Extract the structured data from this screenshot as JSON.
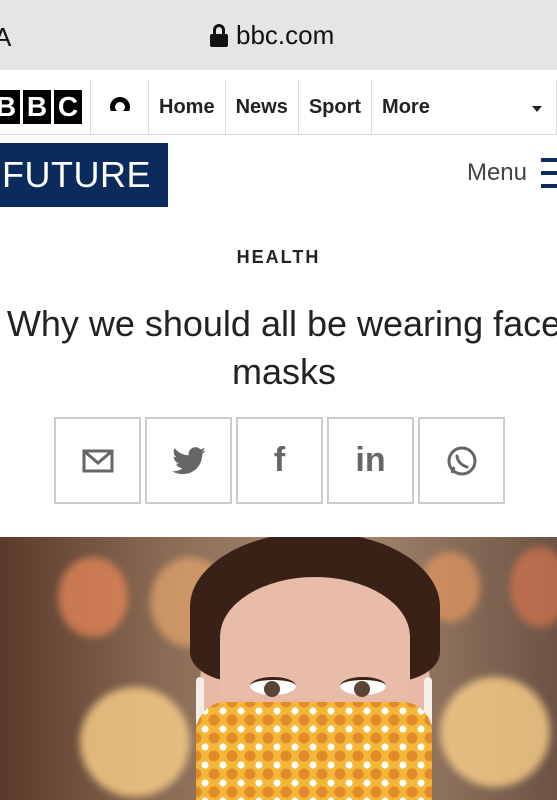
{
  "browser": {
    "text_size_button": "A",
    "url": "bbc.com"
  },
  "nav": {
    "logo": [
      "B",
      "B",
      "C"
    ],
    "items": [
      "Home",
      "News",
      "Sport",
      "More"
    ]
  },
  "section_banner": {
    "title": "FUTURE",
    "menu_label": "Menu"
  },
  "article": {
    "section": "HEALTH",
    "headline": "Why we should all be wearing face masks",
    "share": [
      {
        "name": "email",
        "icon": "email-icon"
      },
      {
        "name": "twitter",
        "icon": "twitter-icon"
      },
      {
        "name": "facebook",
        "icon": "facebook-icon",
        "glyph": "f"
      },
      {
        "name": "linkedin",
        "icon": "linkedin-icon",
        "glyph": "in"
      },
      {
        "name": "whatsapp",
        "icon": "whatsapp-icon"
      }
    ]
  },
  "colors": {
    "brand_navy": "#0b2b5c",
    "mask_yellow": "#f4b838"
  }
}
